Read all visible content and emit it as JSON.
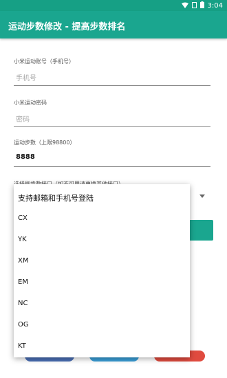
{
  "status_bar": {
    "time": "3:04"
  },
  "app": {
    "title": "运动步数修改 - 提高步数排名"
  },
  "form": {
    "account_label": "小米运动账号（手机号）",
    "account_placeholder": "手机号",
    "password_label": "小米运动密码",
    "password_placeholder": "密码",
    "steps_label": "运动步数（上限98800）",
    "steps_value": "8888",
    "interface_label": "选择刷步数接口（如不可用请更换其他接口）"
  },
  "dropdown": {
    "items": [
      "支持邮箱和手机号登陆",
      "CX",
      "YK",
      "XM",
      "EM",
      "NC",
      "OG",
      "KT"
    ]
  },
  "colors": {
    "accent": "#1aa68f",
    "status": "#16a085"
  }
}
